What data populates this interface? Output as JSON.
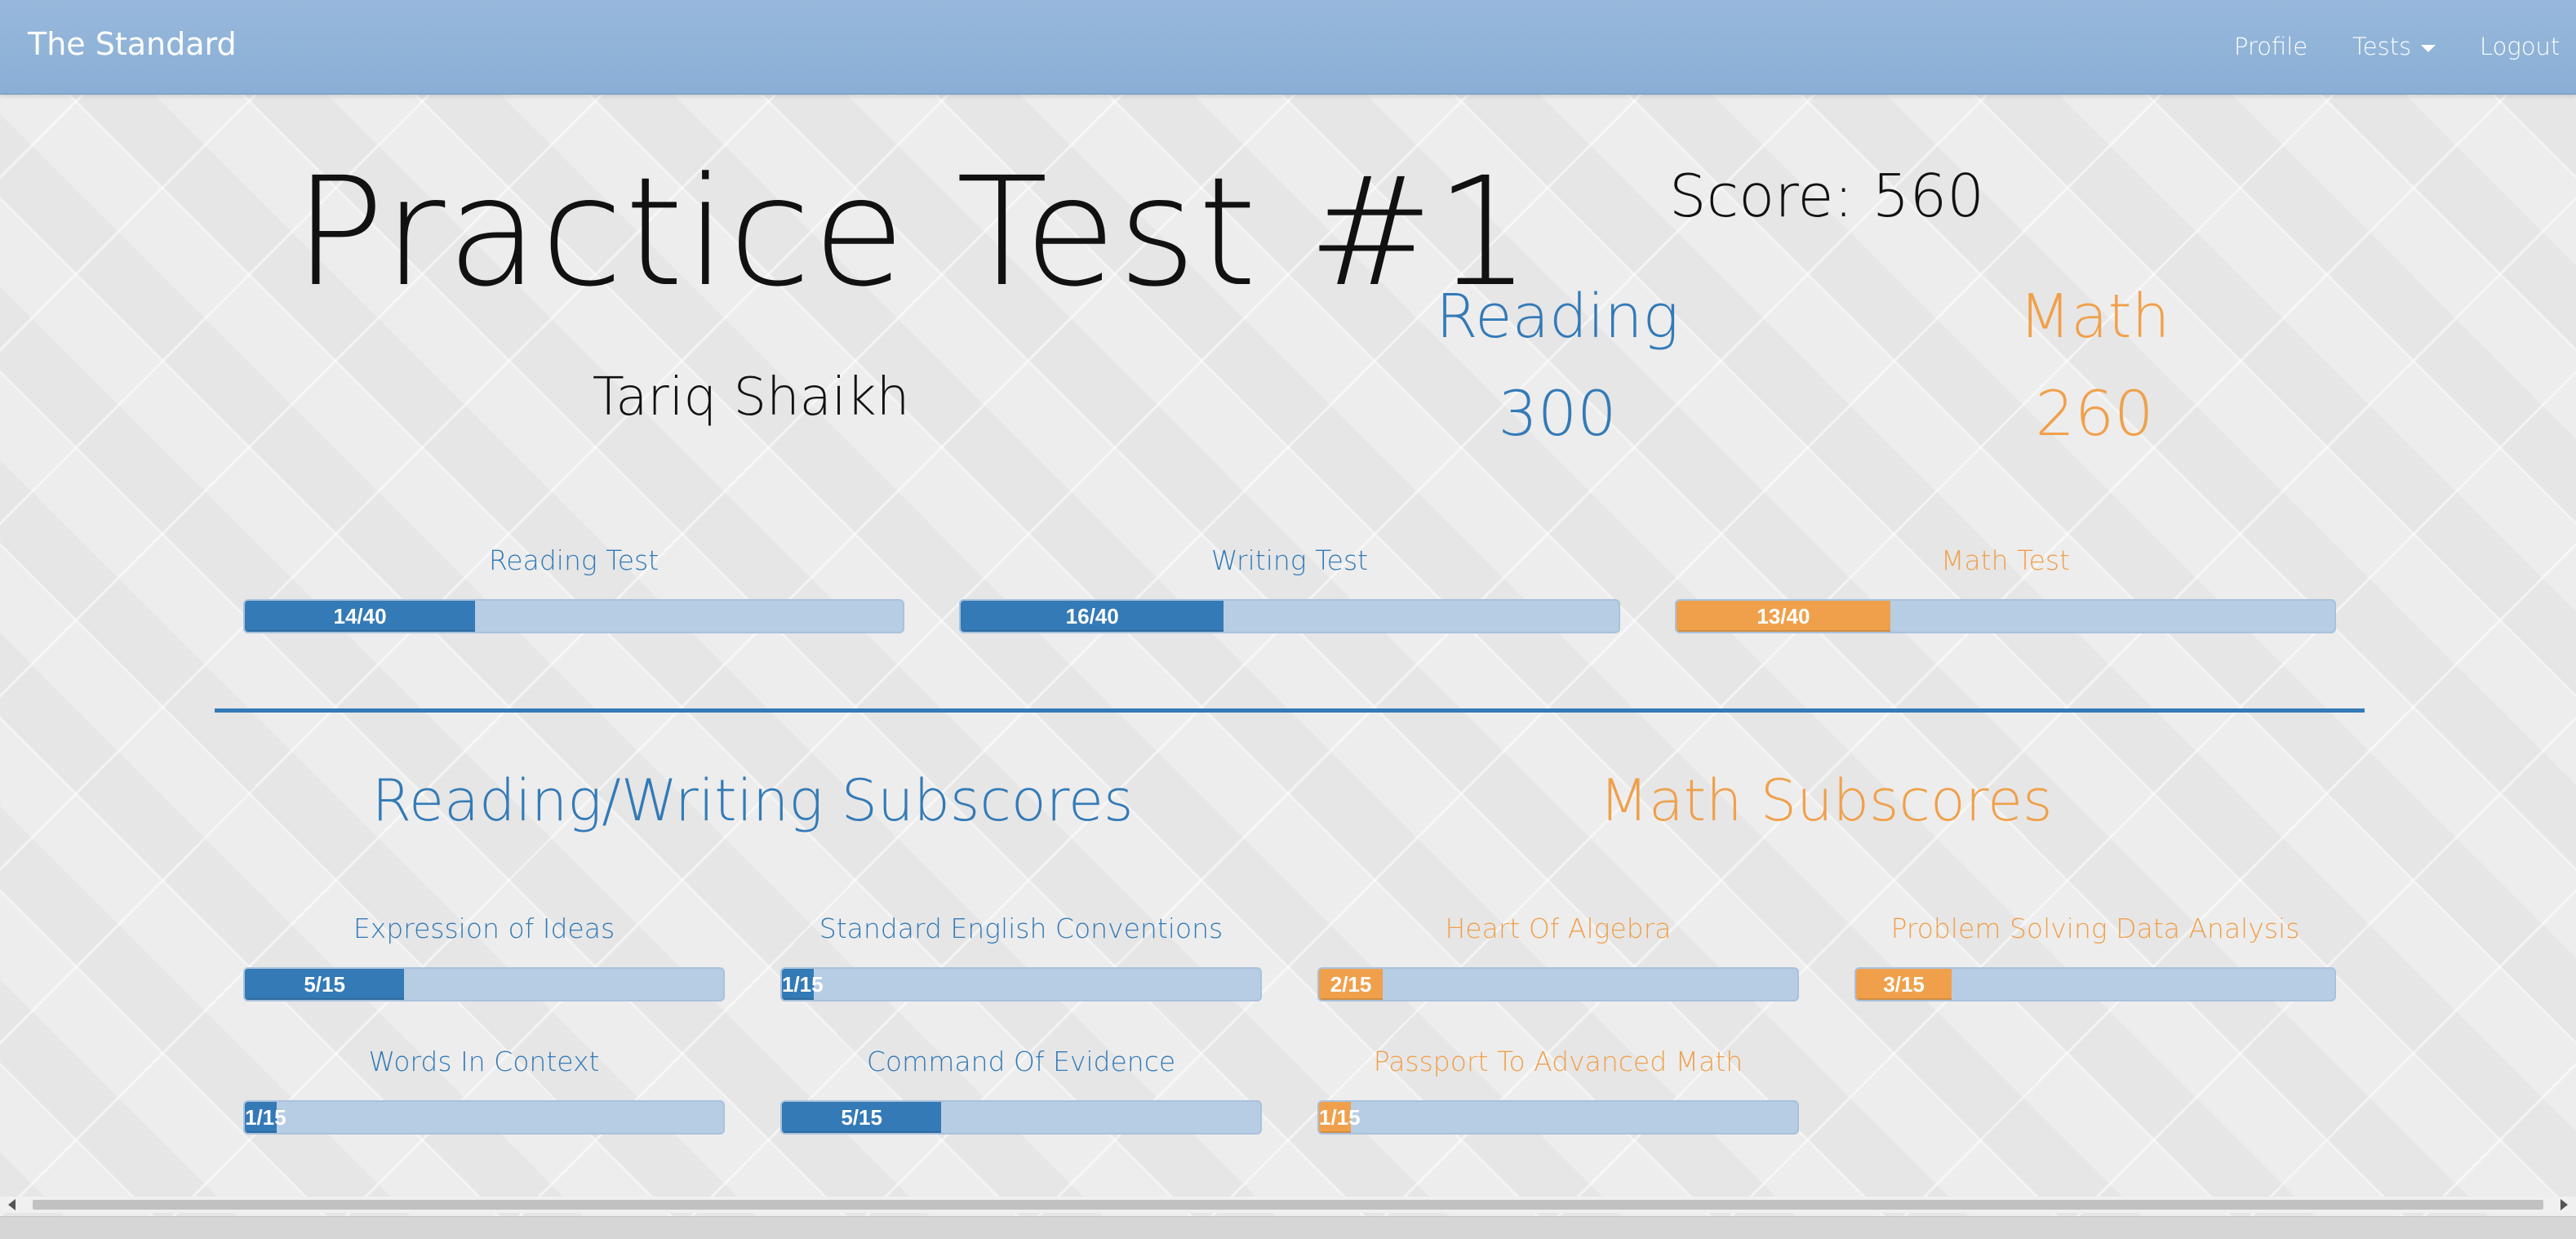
{
  "navbar": {
    "brand": "The Standard",
    "links": {
      "profile": "Profile",
      "tests": "Tests",
      "logout": "Logout"
    }
  },
  "header": {
    "title": "Practice Test #1",
    "student_name": "Tariq Shaikh",
    "total_score": "Score: 560",
    "sections": {
      "reading": {
        "label": "Reading",
        "score": "300"
      },
      "math": {
        "label": "Math",
        "score": "260"
      }
    }
  },
  "tests": [
    {
      "label": "Reading Test",
      "value": "14/40",
      "fraction": 0.35,
      "color": "#337ab7"
    },
    {
      "label": "Writing Test",
      "value": "16/40",
      "fraction": 0.4,
      "color": "#337ab7"
    },
    {
      "label": "Math Test",
      "value": "13/40",
      "fraction": 0.325,
      "color": "#f0a04b"
    }
  ],
  "subscores": {
    "reading_writing_heading": "Reading/Writing Subscores",
    "math_heading": "Math Subscores",
    "items": [
      {
        "label": "Expression of Ideas",
        "value": "5/15",
        "fraction": 0.3333,
        "color": "#337ab7"
      },
      {
        "label": "Standard English Conventions",
        "value": "1/15",
        "fraction": 0.0667,
        "color": "#337ab7"
      },
      {
        "label": "Heart Of Algebra",
        "value": "2/15",
        "fraction": 0.1333,
        "color": "#f0a04b"
      },
      {
        "label": "Problem Solving Data Analysis",
        "value": "3/15",
        "fraction": 0.2,
        "color": "#f0a04b"
      },
      {
        "label": "Words In Context",
        "value": "1/15",
        "fraction": 0.0667,
        "color": "#337ab7"
      },
      {
        "label": "Command Of Evidence",
        "value": "5/15",
        "fraction": 0.3333,
        "color": "#337ab7"
      },
      {
        "label": "Passport To Advanced Math",
        "value": "1/15",
        "fraction": 0.0667,
        "color": "#f0a04b"
      }
    ]
  },
  "colors": {
    "navbar": "#8fb3d9",
    "reading_accent": "#337ab7",
    "math_accent": "#f0a04b",
    "bar_track": "#b7cde4"
  }
}
